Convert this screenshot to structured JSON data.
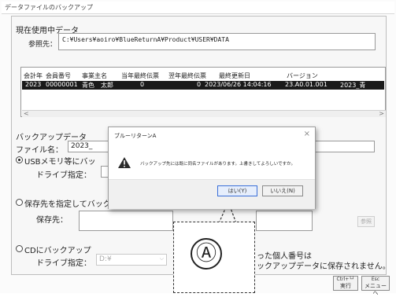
{
  "window": {
    "title": "データファイルのバックアップ"
  },
  "current_data": {
    "section_label": "現在使用中データ",
    "ref_label": "参照先：",
    "ref_path": "C:¥Users¥aoiro¥BlueReturnA¥Product¥USER¥DATA"
  },
  "table": {
    "headers": [
      "会計年",
      "会員番号",
      "事業主名",
      "当年最終伝票",
      "翌年最終伝票",
      "最終更新日",
      "バージョン"
    ],
    "row": [
      "2023",
      "00000001",
      "青色　太郎",
      "0",
      "0",
      "2023/06/26 14:04:16",
      "23.A0.01.001",
      "2023_青"
    ]
  },
  "backup": {
    "section_label": "バックアップデータ",
    "filename_label": "ファイル名：",
    "filename_value": "2023_",
    "usb_option": "USBメモリ等にバッ",
    "drive_label": "ドライブ指定：",
    "dest_option": "保存先を指定してバックアップ",
    "dest_label": "保存先：",
    "dest_button": "参照",
    "cd_option": "CDにバックアップ",
    "cd_drive_label": "ドライブ指定：",
    "cd_drive_value": "D:¥",
    "note_line1": "った個人番号は",
    "note_line2": "ックアップデータに保存されません。"
  },
  "footer": {
    "execute_key": "Ctrl+└┘",
    "execute_label": "実行",
    "menu_key": "Esc",
    "menu_label": "メニューへ"
  },
  "dialog": {
    "title": "ブルーリターンA",
    "close": "×",
    "message": "バックアップ先には既に同名ファイルがあります。上書きしてよろしいですか。",
    "yes_button": "はい(Y)",
    "no_button": "いいえ(N)"
  },
  "callout": {
    "label": "Ⓐ"
  }
}
